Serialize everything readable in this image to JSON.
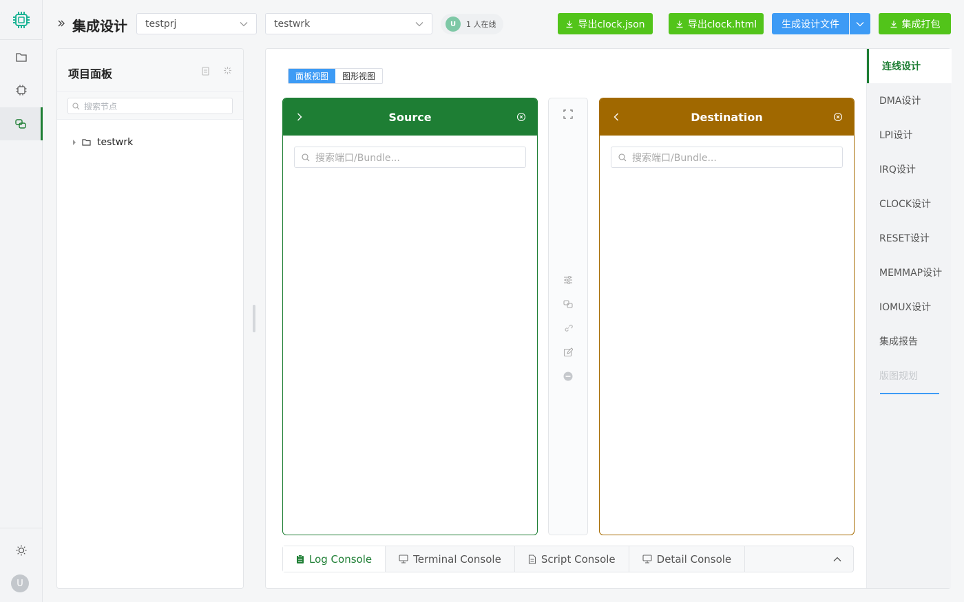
{
  "rail": {
    "avatar_initial": "U"
  },
  "header": {
    "title": "集成设计",
    "project_select": "testprj",
    "workspace_select": "testwrk",
    "online": {
      "initial": "U",
      "text": "1 人在线"
    },
    "buttons": {
      "export_json": "导出clock.json",
      "export_html": "导出clock.html",
      "generate": "生成设计文件",
      "package": "集成打包"
    }
  },
  "project_panel": {
    "title": "项目面板",
    "search_placeholder": "搜索节点",
    "tree": [
      {
        "label": "testwrk"
      }
    ]
  },
  "main": {
    "view_toggle": {
      "panel": "面板视图",
      "graph": "图形视图"
    },
    "source": {
      "title": "Source",
      "search_placeholder": "搜索端口/Bundle..."
    },
    "destination": {
      "title": "Destination",
      "search_placeholder": "搜索端口/Bundle..."
    },
    "consoles": [
      "Log Console",
      "Terminal Console",
      "Script Console",
      "Detail Console"
    ]
  },
  "right_tabs": [
    {
      "label": "连线设计",
      "state": "active"
    },
    {
      "label": "DMA设计",
      "state": "normal"
    },
    {
      "label": "LPI设计",
      "state": "normal"
    },
    {
      "label": "IRQ设计",
      "state": "normal"
    },
    {
      "label": "CLOCK设计",
      "state": "normal"
    },
    {
      "label": "RESET设计",
      "state": "normal"
    },
    {
      "label": "MEMMAP设计",
      "state": "normal"
    },
    {
      "label": "IOMUX设计",
      "state": "normal"
    },
    {
      "label": "集成报告",
      "state": "normal"
    },
    {
      "label": "版图规划",
      "state": "disabled"
    }
  ],
  "colors": {
    "brand_green": "#1e7e34",
    "source_header": "#1e7e34",
    "destination_header": "#a06800",
    "primary_blue": "#3d9bf5",
    "button_green": "#52c41a"
  }
}
